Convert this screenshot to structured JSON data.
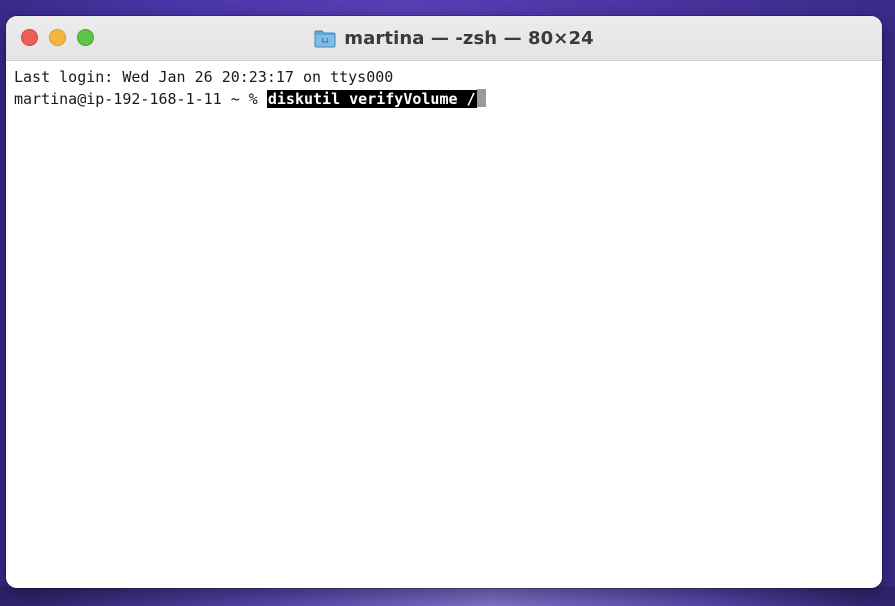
{
  "window": {
    "title": "martina — -zsh — 80×24",
    "folder_icon": "folder-icon",
    "traffic_lights": {
      "close_color": "#ee5d57",
      "minimize_color": "#f4b63f",
      "zoom_color": "#5ec34a"
    }
  },
  "terminal": {
    "last_login": "Last login: Wed Jan 26 20:23:17 on ttys000",
    "prompt": "martina@ip-192-168-1-11 ~ % ",
    "command": "diskutil verifyVolume /"
  }
}
